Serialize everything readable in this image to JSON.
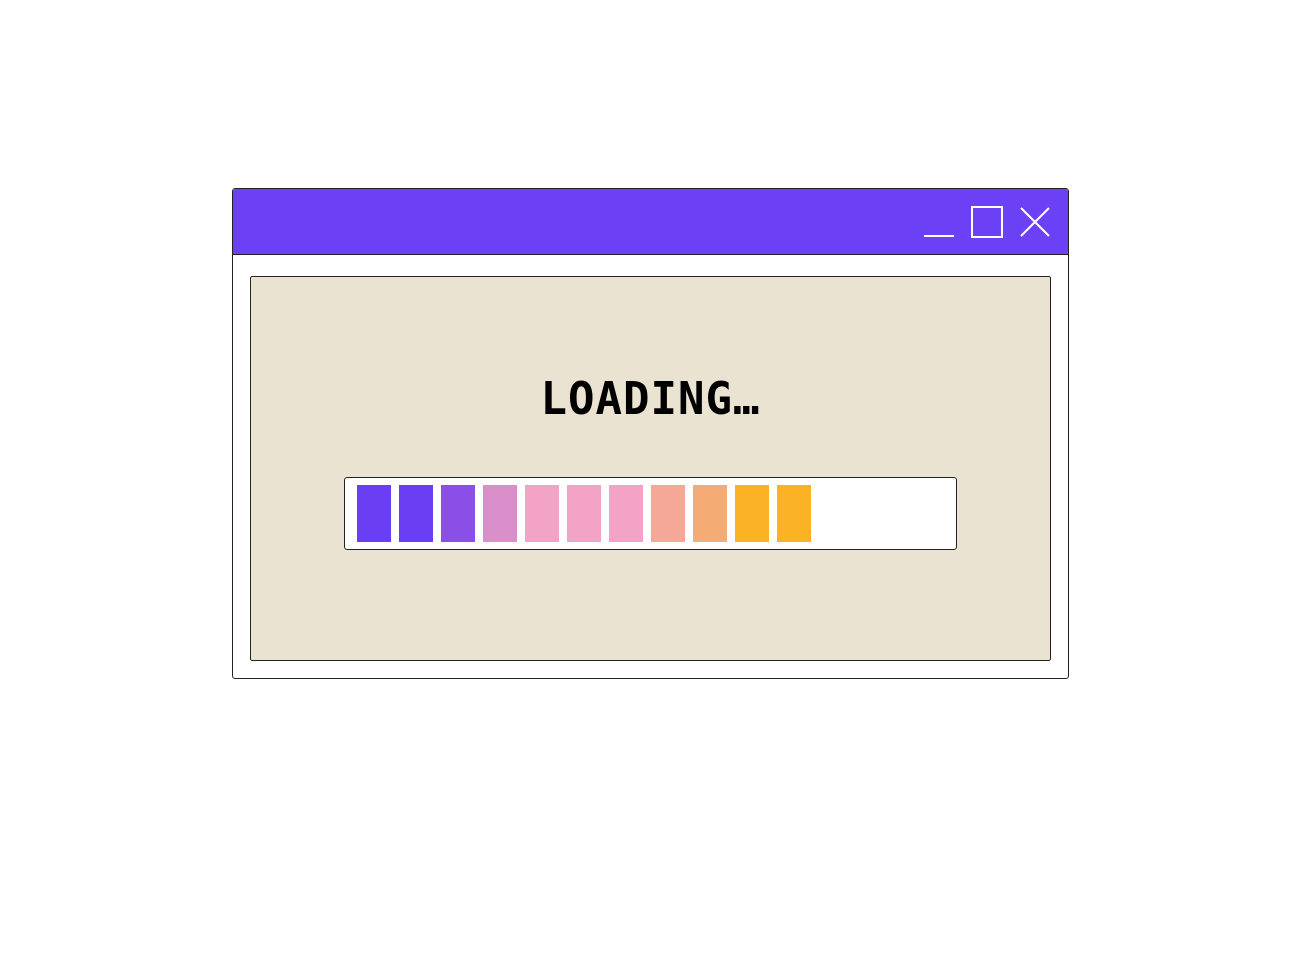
{
  "dialog": {
    "message": "LOADING…",
    "progress": {
      "segments": [
        {
          "color": "#6a3ef2"
        },
        {
          "color": "#6a3ef2"
        },
        {
          "color": "#8a4fe6"
        },
        {
          "color": "#d98fc9"
        },
        {
          "color": "#f2a3c6"
        },
        {
          "color": "#f2a3c6"
        },
        {
          "color": "#f2a3c6"
        },
        {
          "color": "#f5a898"
        },
        {
          "color": "#f5ab74"
        },
        {
          "color": "#fbb224"
        },
        {
          "color": "#fbb224"
        }
      ]
    }
  }
}
